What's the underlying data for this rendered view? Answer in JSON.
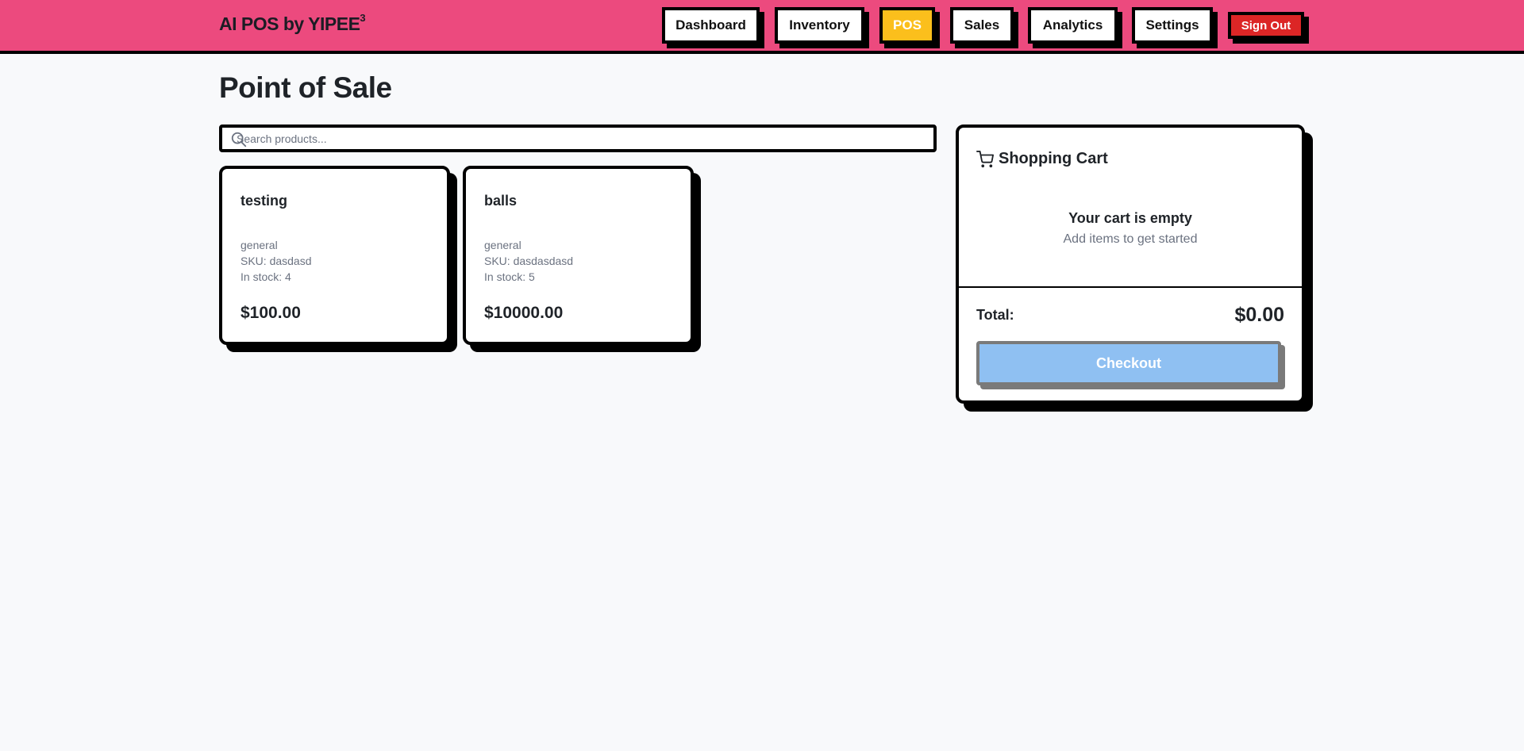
{
  "header": {
    "brand": "AI POS by YIPEE",
    "brand_sup": "3",
    "nav": [
      {
        "label": "Dashboard"
      },
      {
        "label": "Inventory"
      },
      {
        "label": "POS",
        "active": true
      },
      {
        "label": "Sales"
      },
      {
        "label": "Analytics"
      },
      {
        "label": "Settings"
      }
    ],
    "sign_out": "Sign Out"
  },
  "page": {
    "title": "Point of Sale"
  },
  "search": {
    "placeholder": "Search products...",
    "value": ""
  },
  "products": [
    {
      "name": "testing",
      "category": "general",
      "sku": "SKU: dasdasd",
      "stock": "In stock: 4",
      "price": "$100.00"
    },
    {
      "name": "balls",
      "category": "general",
      "sku": "SKU: dasdasdasd",
      "stock": "In stock: 5",
      "price": "$10000.00"
    }
  ],
  "cart": {
    "title": "Shopping Cart",
    "empty_title": "Your cart is empty",
    "empty_sub": "Add items to get started",
    "total_label": "Total:",
    "total_value": "$0.00",
    "checkout": "Checkout"
  },
  "colors": {
    "header_bg": "#ec4a7e",
    "active_nav": "#fbbf1c",
    "sign_out": "#dc2626",
    "checkout_disabled": "#8fc0f2"
  },
  "icons": {
    "search": "search-icon",
    "cart": "shopping-cart-icon"
  }
}
